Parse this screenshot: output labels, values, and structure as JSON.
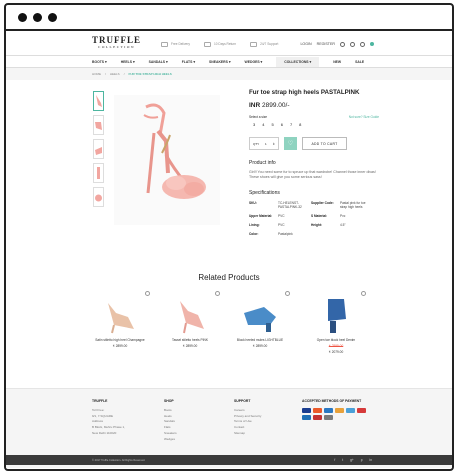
{
  "header": {
    "logo": "TRUFFLE",
    "logo_sub": "COLLECTION",
    "features": [
      "Free Delivery",
      "10 Days Return",
      "24/7 Support"
    ],
    "login": "LOGIN",
    "register": "REGISTER"
  },
  "nav": {
    "items": [
      "BOOTS ▾",
      "HEELS ▾",
      "SANDALS ▾",
      "FLATS ▾",
      "SNEAKERS ▾",
      "WEDGES ▾",
      "COLLECTIONS ▾",
      "NEW",
      "SALE"
    ]
  },
  "breadcrumb": [
    "HOME",
    "/",
    "HEELS",
    "/",
    "FUR TOE STRAP HIGH HEELS"
  ],
  "product": {
    "title": "Fur toe strap high heels PASTALPINK",
    "price_currency": "INR",
    "price_value": "2899.00/-",
    "select_size": "Select a size",
    "size_help": "Not sure? Size Guide",
    "sizes": [
      "3",
      "4",
      "5",
      "6",
      "7",
      "8"
    ],
    "qty_label": "QTY",
    "qty_value": "1",
    "add_to_cart": "ADD TO CART",
    "info_heading": "Product info",
    "description": "Girl!! You need some fur to spruce up that wardrobe! Channel those inner divas! These shoes will give you some serious sass!",
    "spec_heading": "Specifications",
    "specs": [
      [
        "SKU:",
        "TC-HELENST-PASTALPINK-32",
        "Supplier Code:",
        "Pastal pink fur toe strap high heels"
      ],
      [
        "Upper Material:",
        "PVC",
        "S Material:",
        "Pvc"
      ],
      [
        "Lining:",
        "PVC",
        "Height:",
        "4.5\""
      ],
      [
        "Color:",
        "Pastalpink",
        "",
        ""
      ]
    ]
  },
  "related": {
    "title": "Related Products",
    "items": [
      {
        "name": "Satin stiletto high heel Champagne",
        "old": "",
        "price": "₹ 2899.00"
      },
      {
        "name": "Tassel stiletto heels PINK",
        "old": "",
        "price": "₹ 2899.00"
      },
      {
        "name": "Block heeled mules LIGHTBLUE",
        "old": "",
        "price": "₹ 2899.00"
      },
      {
        "name": "Open toe block heel Denim",
        "old": "₹ 2599.00",
        "price": "₹ 2079.00"
      }
    ]
  },
  "footer": {
    "truffle_h": "TRUFFLE",
    "truffle_lines": [
      "Toll Free:",
      "9/1, 7.SQUARE",
      "Address",
      "B Block, Mehru Phase 1,",
      "New Delhi 110020"
    ],
    "shop_h": "SHOP",
    "shop_lines": [
      "Boots",
      "Heels",
      "Sandals",
      "Flats",
      "Sneakers",
      "Wedges"
    ],
    "support_h": "SUPPORT",
    "support_lines": [
      "Careers",
      "Privacy and Security",
      "Terms of Use",
      "Contact",
      "Sitemap"
    ],
    "pay_h": "ACCEPTED METHODS OF PAYMENT",
    "copyright": "© 2017 Truffle Collection. All Rights Reserved.",
    "social": [
      "f",
      "t",
      "g+",
      "p",
      "in"
    ]
  },
  "colors": {
    "accent": "#4db6a0",
    "pink": "#f2a6a0",
    "denim": "#3366a8"
  }
}
